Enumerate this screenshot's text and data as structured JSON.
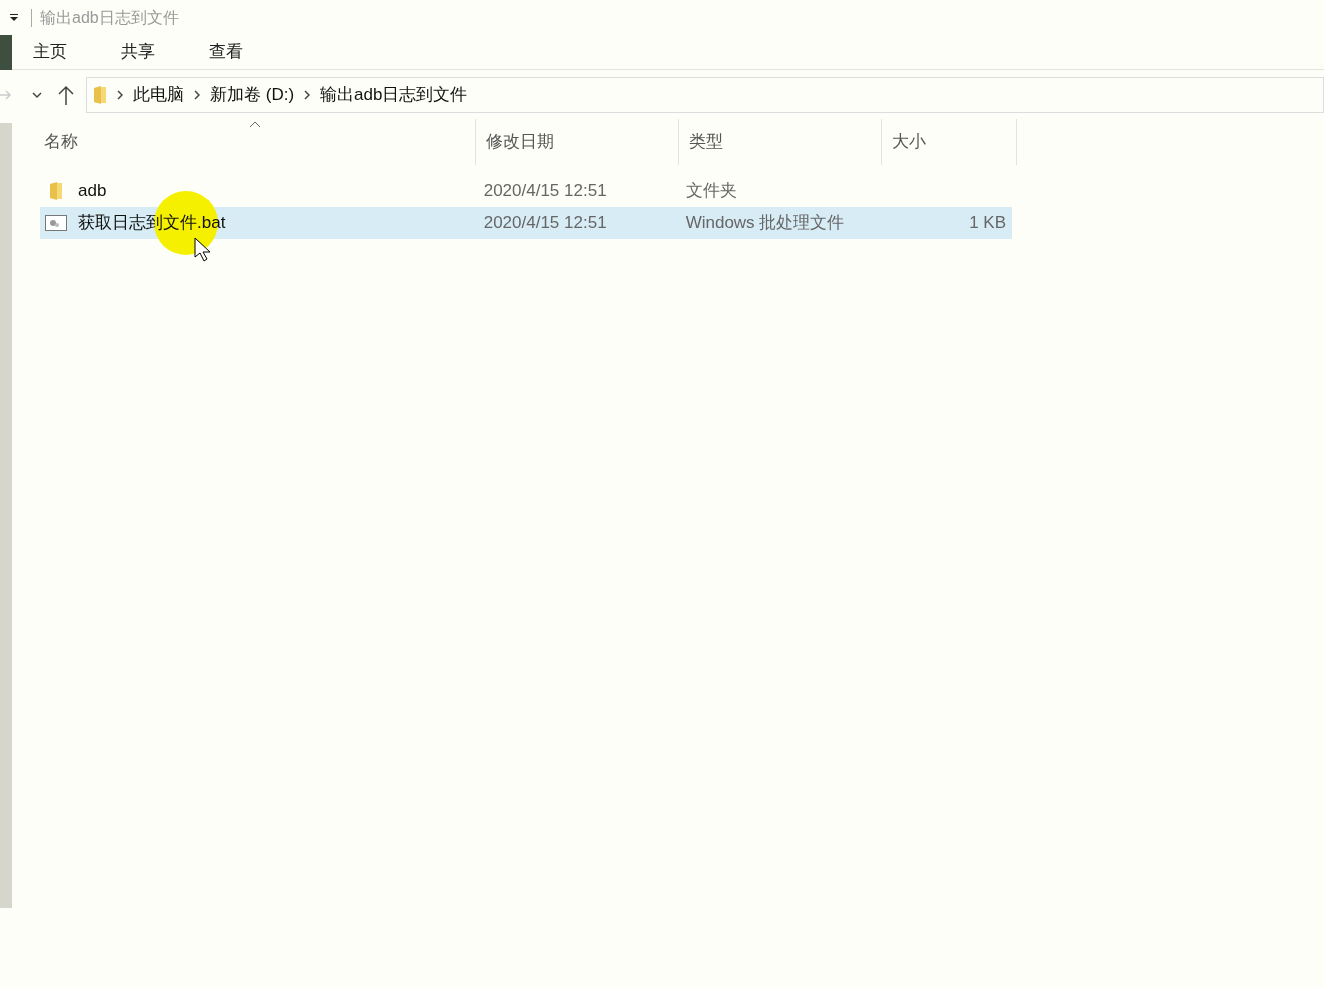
{
  "window": {
    "title": "输出adb日志到文件"
  },
  "ribbon_tabs": [
    {
      "label": "主页",
      "selected": false
    },
    {
      "label": "共享",
      "selected": false
    },
    {
      "label": "查看",
      "selected": false
    }
  ],
  "breadcrumb": [
    "此电脑",
    "新加卷 (D:)",
    "输出adb日志到文件"
  ],
  "table": {
    "columns": [
      "名称",
      "修改日期",
      "类型",
      "大小"
    ],
    "rows": [
      {
        "kind": "folder",
        "name": "adb",
        "date": "2020/4/15 12:51",
        "type": "文件夹",
        "size": null,
        "selected": false
      },
      {
        "kind": "batch",
        "name": "获取日志到文件.bat",
        "date": "2020/4/15 12:51",
        "type": "Windows 批处理文件",
        "size": "1 KB",
        "selected": true
      }
    ]
  }
}
